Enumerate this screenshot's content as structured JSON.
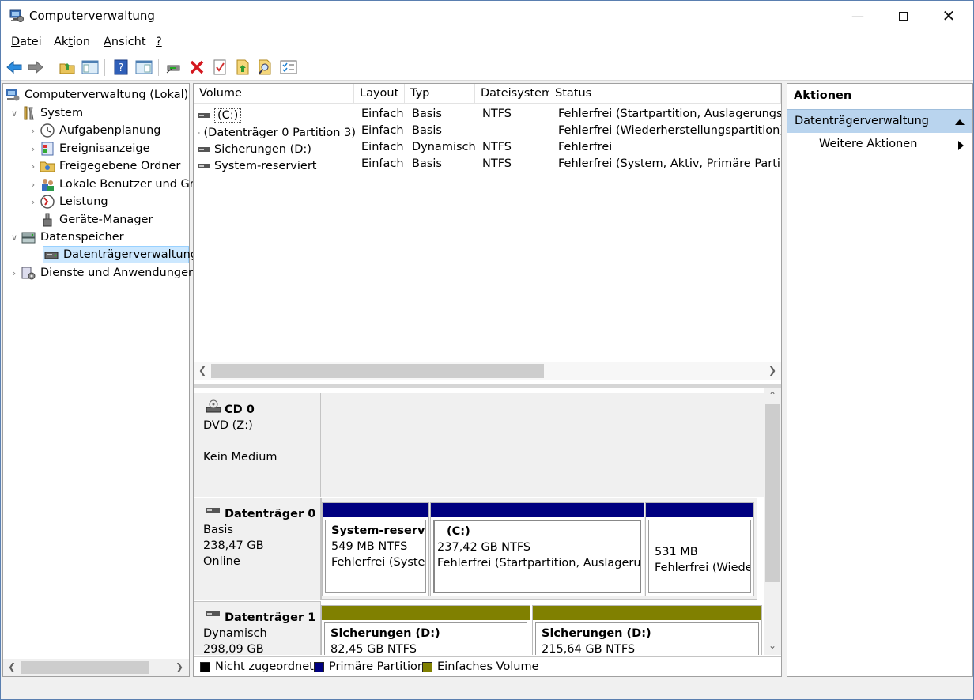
{
  "window": {
    "title": "Computerverwaltung"
  },
  "menu": [
    {
      "pre": "",
      "u": "D",
      "post": "atei"
    },
    {
      "pre": "Ak",
      "u": "t",
      "post": "ion"
    },
    {
      "pre": "",
      "u": "A",
      "post": "nsicht"
    },
    {
      "pre": "",
      "u": "?",
      "post": ""
    }
  ],
  "toolbar_icons": [
    "back-arrow-icon",
    "forward-arrow-icon",
    "up-folder-icon",
    "show-hide-tree-icon",
    "help-icon",
    "properties-icon",
    "connect-icon",
    "delete-icon",
    "check-icon",
    "export-icon",
    "search-icon",
    "list-icon"
  ],
  "tree": {
    "root": "Computerverwaltung (Lokal)",
    "system": "System",
    "items_system": [
      "Aufgabenplanung",
      "Ereignisanzeige",
      "Freigegebene Ordner",
      "Lokale Benutzer und Gru",
      "Leistung",
      "Geräte-Manager"
    ],
    "storage": "Datenspeicher",
    "disk_mgmt": "Datenträgerverwaltung",
    "services": "Dienste und Anwendungen"
  },
  "volumes": {
    "columns": [
      "Volume",
      "Layout",
      "Typ",
      "Dateisystem",
      "Status"
    ],
    "rows": [
      {
        "volume": "(C:)",
        "layout": "Einfach",
        "type": "Basis",
        "fs": "NTFS",
        "status": "Fehlerfrei (Startpartition, Auslagerungsdate"
      },
      {
        "volume": "(Datenträger 0 Partition 3)",
        "layout": "Einfach",
        "type": "Basis",
        "fs": "",
        "status": "Fehlerfrei (Wiederherstellungspartition)"
      },
      {
        "volume": "Sicherungen (D:)",
        "layout": "Einfach",
        "type": "Dynamisch",
        "fs": "NTFS",
        "status": "Fehlerfrei"
      },
      {
        "volume": "System-reserviert",
        "layout": "Einfach",
        "type": "Basis",
        "fs": "NTFS",
        "status": "Fehlerfrei (System, Aktiv, Primäre Partition)"
      }
    ]
  },
  "disks": {
    "cd0": {
      "name": "CD 0",
      "drive": "DVD (Z:)",
      "media": "Kein Medium"
    },
    "disk0": {
      "name": "Datenträger 0",
      "kind": "Basis",
      "size": "238,47 GB",
      "state": "Online",
      "parts": [
        {
          "name": "System-reservier",
          "size": "549 MB NTFS",
          "status": "Fehlerfrei (System"
        },
        {
          "name": "(C:)",
          "size": "237,42 GB NTFS",
          "status": "Fehlerfrei (Startpartition, Auslagerung"
        },
        {
          "name": "",
          "size": "531 MB",
          "status": "Fehlerfrei (Wieder"
        }
      ]
    },
    "disk1": {
      "name": "Datenträger 1",
      "kind": "Dynamisch",
      "size": "298,09 GB",
      "parts": [
        {
          "name": "Sicherungen  (D:)",
          "size": "82,45 GB NTFS"
        },
        {
          "name": "Sicherungen  (D:)",
          "size": "215,64 GB NTFS"
        }
      ]
    }
  },
  "legend": [
    {
      "label": "Nicht zugeordnet",
      "color": "#000000"
    },
    {
      "label": "Primäre Partition",
      "color": "#000080"
    },
    {
      "label": "Einfaches Volume",
      "color": "#808000"
    }
  ],
  "actions": {
    "title": "Aktionen",
    "section": "Datenträgerverwaltung",
    "more": "Weitere Aktionen"
  },
  "colors": {
    "primary": "#000080",
    "simple": "#808000",
    "selection": "#cce8ff"
  }
}
